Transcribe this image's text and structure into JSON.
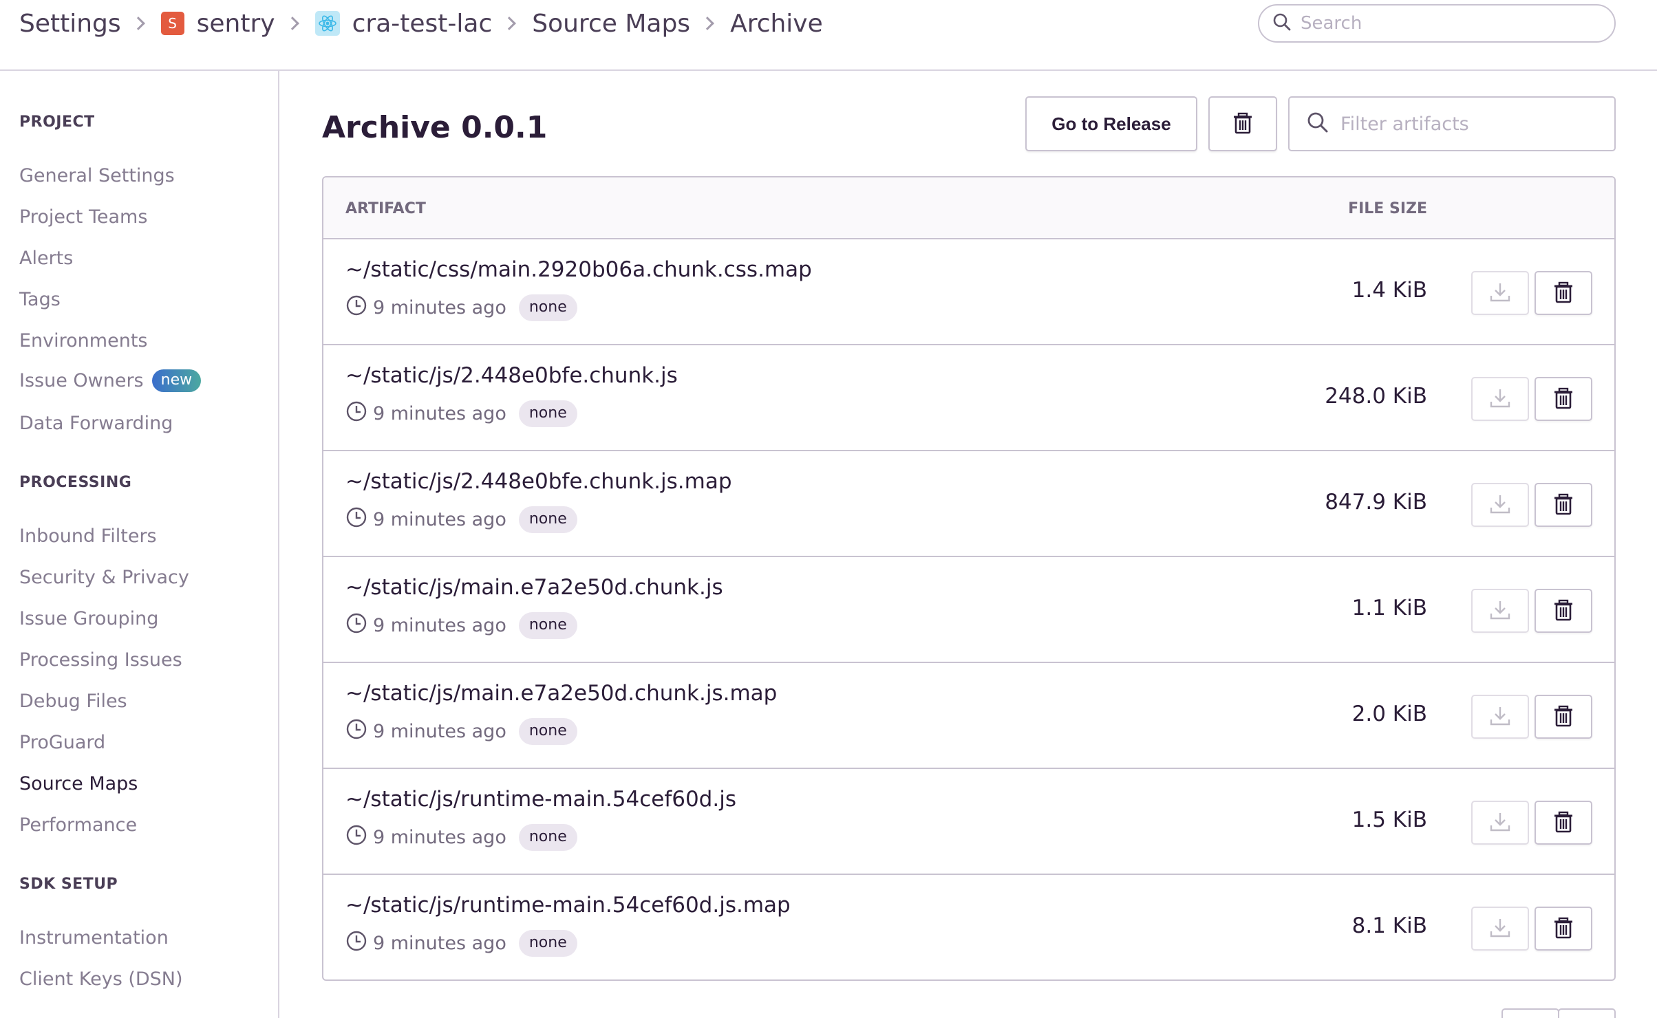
{
  "breadcrumb": {
    "items": [
      {
        "label": "Settings"
      },
      {
        "label": "sentry",
        "badge": "S"
      },
      {
        "label": "cra-test-lac"
      },
      {
        "label": "Source Maps"
      },
      {
        "label": "Archive"
      }
    ]
  },
  "search": {
    "placeholder": "Search"
  },
  "sidebar": {
    "sections": [
      {
        "title": "PROJECT",
        "items": [
          "General Settings",
          "Project Teams",
          "Alerts",
          "Tags",
          "Environments",
          "Issue Owners",
          "Data Forwarding"
        ]
      },
      {
        "title": "PROCESSING",
        "items": [
          "Inbound Filters",
          "Security & Privacy",
          "Issue Grouping",
          "Processing Issues",
          "Debug Files",
          "ProGuard",
          "Source Maps",
          "Performance"
        ]
      },
      {
        "title": "SDK SETUP",
        "items": [
          "Instrumentation",
          "Client Keys (DSN)"
        ]
      }
    ],
    "new_badge": "new",
    "active_item": "Source Maps"
  },
  "main": {
    "title": "Archive 0.0.1",
    "go_to_release": "Go to Release",
    "filter_placeholder": "Filter artifacts",
    "table": {
      "columns": [
        "ARTIFACT",
        "FILE SIZE"
      ],
      "rows": [
        {
          "name": "~/static/css/main.2920b06a.chunk.css.map",
          "time": "9 minutes ago",
          "tag": "none",
          "size": "1.4 KiB"
        },
        {
          "name": "~/static/js/2.448e0bfe.chunk.js",
          "time": "9 minutes ago",
          "tag": "none",
          "size": "248.0 KiB"
        },
        {
          "name": "~/static/js/2.448e0bfe.chunk.js.map",
          "time": "9 minutes ago",
          "tag": "none",
          "size": "847.9 KiB"
        },
        {
          "name": "~/static/js/main.e7a2e50d.chunk.js",
          "time": "9 minutes ago",
          "tag": "none",
          "size": "1.1 KiB"
        },
        {
          "name": "~/static/js/main.e7a2e50d.chunk.js.map",
          "time": "9 minutes ago",
          "tag": "none",
          "size": "2.0 KiB"
        },
        {
          "name": "~/static/js/runtime-main.54cef60d.js",
          "time": "9 minutes ago",
          "tag": "none",
          "size": "1.5 KiB"
        },
        {
          "name": "~/static/js/runtime-main.54cef60d.js.map",
          "time": "9 minutes ago",
          "tag": "none",
          "size": "8.1 KiB"
        }
      ]
    }
  },
  "icons": {
    "search": "search-icon",
    "trash": "trash-icon",
    "download": "download-icon",
    "clock": "clock-icon",
    "chevron": "chevron-right-icon"
  },
  "colors": {
    "text": "#2b1d38",
    "muted": "#857c90",
    "border": "#c9c3d1",
    "project_badge": "#e35b3f",
    "new_badge_start": "#3b6ecc",
    "new_badge_end": "#4ca8a0"
  }
}
